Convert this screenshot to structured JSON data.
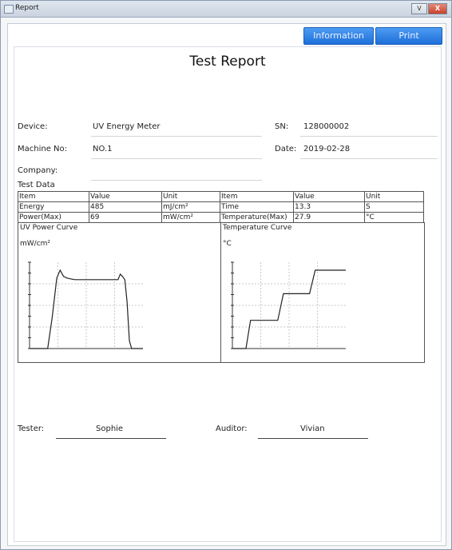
{
  "window": {
    "title": "Report",
    "minimize_label": "V",
    "close_label": "X"
  },
  "toolbar": {
    "information_label": "Information",
    "print_label": "Print"
  },
  "report": {
    "title": "Test Report",
    "device_label": "Device:",
    "device_value": "UV Energy Meter",
    "sn_label": "SN:",
    "sn_value": "128000002",
    "machine_label": "Machine No:",
    "machine_value": "NO.1",
    "date_label": "Date:",
    "date_value": "2019-02-28",
    "company_label": "Company:",
    "company_value": ""
  },
  "test_data": {
    "title": "Test Data",
    "rows": [
      [
        "Item",
        "Value",
        "Unit",
        "Item",
        "Value",
        "Unit"
      ],
      [
        "Energy",
        "485",
        "mJ/cm²",
        "Time",
        "13.3",
        "S"
      ],
      [
        "Power(Max)",
        "69",
        "mW/cm²",
        "Temperature(Max)",
        "27.9",
        "°C"
      ]
    ]
  },
  "charts": {
    "uv": {
      "title": "UV Power Curve",
      "unit": "mW/cm²"
    },
    "temp": {
      "title": "Temperature Curve",
      "unit": "°C"
    }
  },
  "chart_data": [
    {
      "type": "line",
      "title": "UV Power Curve",
      "ylabel": "mW/cm²",
      "x": [
        0,
        0.16,
        0.2,
        0.24,
        0.27,
        0.3,
        0.33,
        0.36,
        0.4,
        0.5,
        0.6,
        0.7,
        0.78,
        0.8,
        0.82,
        0.84,
        0.86,
        0.88,
        0.9,
        1.0
      ],
      "y": [
        0,
        0,
        40,
        90,
        100,
        92,
        90,
        89,
        88,
        88,
        88,
        88,
        88,
        95,
        92,
        88,
        60,
        10,
        0,
        0
      ]
    },
    {
      "type": "line",
      "title": "Temperature Curve",
      "ylabel": "°C",
      "x": [
        0,
        0.12,
        0.16,
        0.4,
        0.45,
        0.68,
        0.73,
        1.0
      ],
      "y": [
        0,
        0,
        36,
        36,
        70,
        70,
        100,
        100
      ]
    }
  ],
  "signature": {
    "tester_label": "Tester:",
    "tester_value": "Sophie",
    "auditor_label": "Auditor:",
    "auditor_value": "Vivian"
  }
}
